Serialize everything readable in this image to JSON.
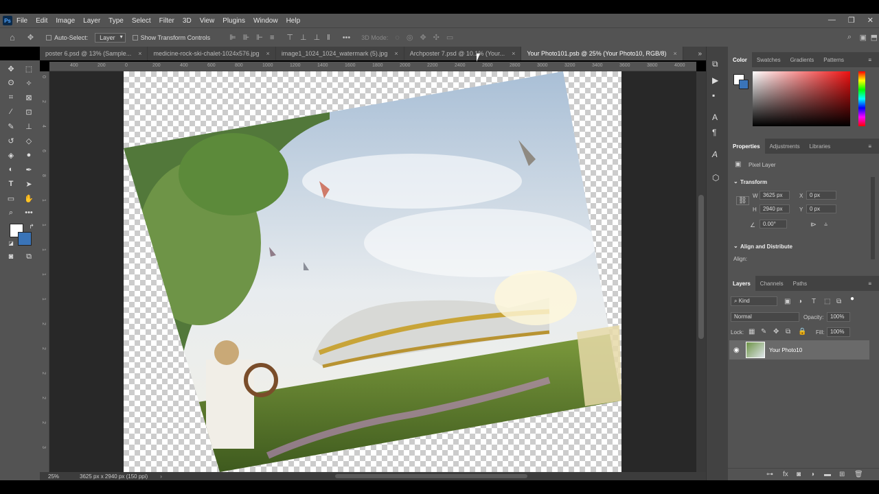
{
  "app": {
    "logo": "Ps"
  },
  "menu": [
    "File",
    "Edit",
    "Image",
    "Layer",
    "Type",
    "Select",
    "Filter",
    "3D",
    "View",
    "Plugins",
    "Window",
    "Help"
  ],
  "options": {
    "auto_select": "Auto-Select:",
    "layer_select": "Layer",
    "show_transform": "Show Transform Controls",
    "mode_3d": "3D Mode:"
  },
  "tabs": [
    {
      "label": "poster 6.psd @ 13% (Sample..."
    },
    {
      "label": "medicine-rock-ski-chalet-1024x576.jpg"
    },
    {
      "label": "image1_1024_1024_watermark (5).jpg"
    },
    {
      "label": "Archposter 7.psd @ 10.1% (Your..."
    },
    {
      "label": "Your Photo101.psb @ 25% (Your Photo10, RGB/8)",
      "active": true
    }
  ],
  "ruler": {
    "h": [
      "400",
      "200",
      "0",
      "200",
      "400",
      "600",
      "800",
      "1000",
      "1200",
      "1400",
      "1600",
      "1800",
      "2000",
      "2200",
      "2400",
      "2600",
      "2800",
      "3000",
      "3200",
      "3400",
      "3600",
      "3800",
      "4000"
    ],
    "v": [
      "0",
      "2",
      "4",
      "6",
      "8",
      "1",
      "1",
      "1",
      "1",
      "1",
      "2",
      "2",
      "2",
      "2",
      "2",
      "3"
    ]
  },
  "status": {
    "zoom": "25%",
    "doc": "3625 px x 2940 px (150 ppi)"
  },
  "color_panel": {
    "tabs": [
      "Color",
      "Swatches",
      "Gradients",
      "Patterns"
    ]
  },
  "properties_panel": {
    "tabs": [
      "Properties",
      "Adjustments",
      "Libraries"
    ],
    "layer_type": "Pixel Layer",
    "transform_title": "Transform",
    "w_label": "W",
    "w_value": "3625 px",
    "h_label": "H",
    "h_value": "2940 px",
    "x_label": "X",
    "x_value": "0 px",
    "y_label": "Y",
    "y_value": "0 px",
    "angle_value": "0.00°",
    "align_title": "Align and Distribute",
    "align_label": "Align:"
  },
  "layers_panel": {
    "tabs": [
      "Layers",
      "Channels",
      "Paths"
    ],
    "kind": "Kind",
    "blend": "Normal",
    "opacity_label": "Opacity:",
    "opacity_value": "100%",
    "lock_label": "Lock:",
    "fill_label": "Fill:",
    "fill_value": "100%",
    "layers": [
      {
        "name": "Your Photo10"
      }
    ]
  }
}
